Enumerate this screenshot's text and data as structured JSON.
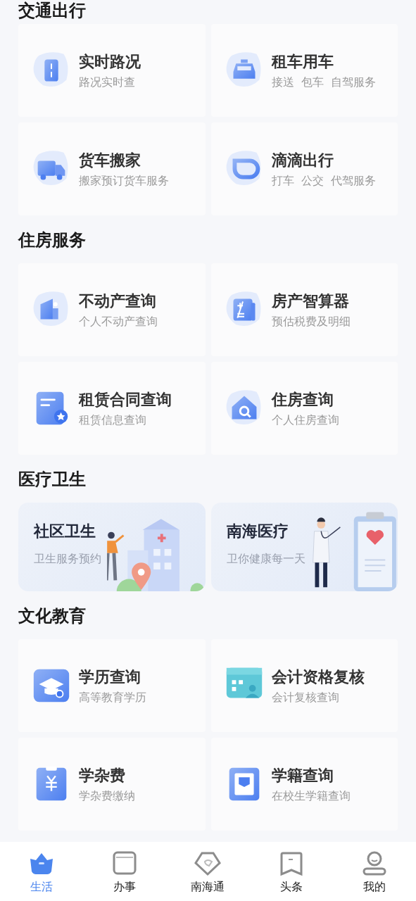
{
  "sections": [
    {
      "title": "交通出行",
      "kind": "grid",
      "items": [
        {
          "title": "实时路况",
          "subtitle": "路况实时查"
        },
        {
          "title": "租车用车",
          "subtitle": "接送  包车  自驾服务"
        },
        {
          "title": "货车搬家",
          "subtitle": "搬家预订货车服务"
        },
        {
          "title": "滴滴出行",
          "subtitle": "打车  公交  代驾服务"
        }
      ]
    },
    {
      "title": "住房服务",
      "kind": "grid",
      "items": [
        {
          "title": "不动产查询",
          "subtitle": "个人不动产查询"
        },
        {
          "title": "房产智算器",
          "subtitle": "预估税费及明细"
        },
        {
          "title": "租赁合同查询",
          "subtitle": "租赁信息查询"
        },
        {
          "title": "住房查询",
          "subtitle": "个人住房查询"
        }
      ]
    },
    {
      "title": "医疗卫生",
      "kind": "banner",
      "items": [
        {
          "title": "社区卫生",
          "subtitle": "卫生服务预约"
        },
        {
          "title": "南海医疗",
          "subtitle": "卫你健康每一天"
        }
      ]
    },
    {
      "title": "文化教育",
      "kind": "grid",
      "items": [
        {
          "title": "学历查询",
          "subtitle": "高等教育学历"
        },
        {
          "title": "会计资格复核",
          "subtitle": "会计复核查询"
        },
        {
          "title": "学杂费",
          "subtitle": "学杂费缴纳"
        },
        {
          "title": "学籍查询",
          "subtitle": "在校生学籍查询"
        }
      ]
    }
  ],
  "nav": [
    {
      "label": "生活",
      "selected": true
    },
    {
      "label": "办事",
      "selected": false
    },
    {
      "label": "南海通",
      "selected": false
    },
    {
      "label": "头条",
      "selected": false
    },
    {
      "label": "我的",
      "selected": false
    }
  ]
}
